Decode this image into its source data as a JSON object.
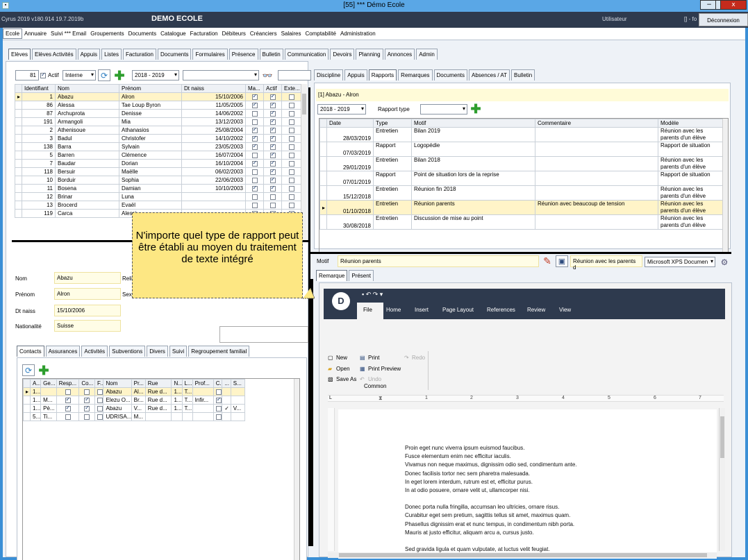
{
  "window": {
    "title": "[55] *** Démo Ecole",
    "app_icon": "app-icon",
    "minimize": "−",
    "maximize": "□",
    "close": "x"
  },
  "appbar": {
    "version": "Cyrus 2019 v180.914 19.7.2019b",
    "school": "DEMO ECOLE",
    "user_label": "Utilisateur",
    "user_suffix": "[] - fo",
    "logout": "Déconnexion"
  },
  "menu": [
    "Ecole",
    "Annuaire",
    "Suivi *** Email",
    "Groupements",
    "Documents",
    "Catalogue",
    "Facturation",
    "Débiteurs",
    "Créanciers",
    "Salaires",
    "Comptabilité",
    "Administration"
  ],
  "subtabs": [
    "Elèves",
    "Elèves Activités",
    "Appuis",
    "Listes",
    "Facturation",
    "Documents",
    "Formulaires",
    "Présence",
    "Bulletin",
    "Communication",
    "Devoirs",
    "Planning",
    "Annonces",
    "Admin"
  ],
  "filter": {
    "count": "81",
    "actif_label": "Actif",
    "type": "Interne",
    "year": "2018 - 2019",
    "search_value": "",
    "search2_value": ""
  },
  "students": {
    "columns": [
      "Identifiant",
      "Nom",
      "Prénom",
      "Dt naiss",
      "Ma...",
      "Actif",
      "Exte..."
    ],
    "rows": [
      {
        "id": "1",
        "nom": "Abazu",
        "prenom": "Alron",
        "dt": "15/10/2006",
        "ma": true,
        "actif": true,
        "ext": false
      },
      {
        "id": "86",
        "nom": "Alessa",
        "prenom": "Tae Loup Byron",
        "dt": "11/05/2005",
        "ma": true,
        "actif": true,
        "ext": false
      },
      {
        "id": "87",
        "nom": "Archuprota",
        "prenom": "Denisse",
        "dt": "14/06/2002",
        "ma": false,
        "actif": true,
        "ext": false
      },
      {
        "id": "191",
        "nom": "Armangoli",
        "prenom": "Mia",
        "dt": "13/12/2003",
        "ma": false,
        "actif": true,
        "ext": false
      },
      {
        "id": "2",
        "nom": "Athenisoue",
        "prenom": "Athanasios",
        "dt": "25/08/2004",
        "ma": true,
        "actif": true,
        "ext": false
      },
      {
        "id": "3",
        "nom": "Badul",
        "prenom": "Christofer",
        "dt": "14/10/2002",
        "ma": true,
        "actif": true,
        "ext": false
      },
      {
        "id": "138",
        "nom": "Barra",
        "prenom": "Sylvain",
        "dt": "23/05/2003",
        "ma": true,
        "actif": true,
        "ext": false
      },
      {
        "id": "5",
        "nom": "Barren",
        "prenom": "Clémence",
        "dt": "16/07/2004",
        "ma": false,
        "actif": true,
        "ext": false
      },
      {
        "id": "7",
        "nom": "Baudar",
        "prenom": "Dorian",
        "dt": "16/10/2004",
        "ma": true,
        "actif": true,
        "ext": false
      },
      {
        "id": "118",
        "nom": "Bersuir",
        "prenom": "Maëlle",
        "dt": "06/02/2003",
        "ma": false,
        "actif": true,
        "ext": false
      },
      {
        "id": "10",
        "nom": "Borduir",
        "prenom": "Sophia",
        "dt": "22/06/2003",
        "ma": false,
        "actif": true,
        "ext": false
      },
      {
        "id": "11",
        "nom": "Bosena",
        "prenom": "Damian",
        "dt": "10/10/2003",
        "ma": true,
        "actif": true,
        "ext": false
      },
      {
        "id": "12",
        "nom": "Brinar",
        "prenom": "Luna",
        "dt": "",
        "ma": false,
        "actif": false,
        "ext": false
      },
      {
        "id": "13",
        "nom": "Brocerd",
        "prenom": "Evaël",
        "dt": "",
        "ma": false,
        "actif": false,
        "ext": false
      },
      {
        "id": "119",
        "nom": "Carca",
        "prenom": "Alessi",
        "dt": "",
        "ma": false,
        "actif": false,
        "ext": false
      }
    ]
  },
  "detail": {
    "nom_label": "Nom",
    "nom": "Abazu",
    "relig_label": "Relig",
    "prenom_label": "Prénom",
    "prenom": "Alron",
    "sexe_label": "Sexe",
    "dtnaiss_label": "Dt naiss",
    "dtnaiss": "15/10/2006",
    "nat_label": "Nationalité",
    "nat": "Suisse"
  },
  "contact_tabs": [
    "Contacts",
    "Assurances",
    "Activités",
    "Subventions",
    "Divers",
    "Suivi",
    "Regroupement familial"
  ],
  "contacts": {
    "columns": [
      "A...",
      "Ge...",
      "Resp...",
      "Co...",
      "F...",
      "Nom",
      "Pr...",
      "Rue",
      "N...",
      "L...",
      "Prof...",
      "C...",
      "...",
      "S..."
    ],
    "rows": [
      {
        "a": "1...",
        "ge": "",
        "resp": false,
        "co": false,
        "f": false,
        "nom": "Abazu",
        "pr": "Al...",
        "rue": "Rue d...",
        "n": "1...",
        "l": "T...",
        "prof": "",
        "c": false,
        "x": "",
        "s": ""
      },
      {
        "a": "1...",
        "ge": "M...",
        "resp": true,
        "co": true,
        "f": false,
        "nom": "Elezu O...",
        "pr": "Br...",
        "rue": "Rue d...",
        "n": "1...",
        "l": "T...",
        "prof": "Infir...",
        "c": true,
        "x": "",
        "s": ""
      },
      {
        "a": "1...",
        "ge": "Pè...",
        "resp": true,
        "co": true,
        "f": false,
        "nom": "Abazu",
        "pr": "V...",
        "rue": "Rue d...",
        "n": "1...",
        "l": "T...",
        "prof": "",
        "c": false,
        "x": "✓",
        "s": "V..."
      },
      {
        "a": "5...",
        "ge": "Ti...",
        "resp": false,
        "co": false,
        "f": false,
        "nom": "UDRISA...",
        "pr": "M...",
        "rue": "",
        "n": "",
        "l": "",
        "prof": "",
        "c": false,
        "x": "",
        "s": ""
      }
    ]
  },
  "right_tabs": [
    "Discipline",
    "Appuis",
    "Rapports",
    "Remarques",
    "Documents",
    "Absences / AT",
    "Bulletin"
  ],
  "selected_student": "[1] Abazu - Alron",
  "report_filter": {
    "year": "2018 - 2019",
    "type_label": "Rapport type",
    "type_value": ""
  },
  "reports": {
    "columns": [
      "Date",
      "Type",
      "Motif",
      "Commentaire",
      "Modèle"
    ],
    "rows": [
      {
        "date": "28/03/2019",
        "type": "Entretien",
        "motif": "Bilan 2019",
        "comment": "",
        "modele": "Réunion avec les parents d'un élève"
      },
      {
        "date": "07/03/2019",
        "type": "Rapport",
        "motif": "Logopédie",
        "comment": "",
        "modele": "Rapport de situation"
      },
      {
        "date": "29/01/2019",
        "type": "Entretien",
        "motif": "Bilan 2018",
        "comment": "",
        "modele": "Réunion avec les parents d'un élève"
      },
      {
        "date": "07/01/2019",
        "type": "Rapport",
        "motif": "Point de situation lors de la reprise",
        "comment": "",
        "modele": "Rapport de situation"
      },
      {
        "date": "15/12/2018",
        "type": "Entretien",
        "motif": "Réunion fin 2018",
        "comment": "",
        "modele": "Réunion avec les parents d'un élève"
      },
      {
        "date": "01/10/2018",
        "type": "Entretien",
        "motif": "Réunion parents",
        "comment": "Réunion avec beaucoup de tension",
        "modele": "Réunion avec les parents d'un élève"
      },
      {
        "date": "30/08/2018",
        "type": "Entretien",
        "motif": "Discussion de mise au point",
        "comment": "",
        "modele": "Réunion avec les parents d'un élève"
      }
    ]
  },
  "motif": {
    "label": "Motif",
    "value": "Réunion parents",
    "modele": "Réunion avec les parents d",
    "printer": "Microsoft XPS Documen"
  },
  "editor_tabs": [
    "Remarque",
    "Présent"
  ],
  "tooltip": "N'importe quel type de rapport peut être établi au moyen du traitement de texte intégré",
  "ribbon": {
    "tabs": [
      "File",
      "Home",
      "Insert",
      "Page Layout",
      "References",
      "Review",
      "View"
    ],
    "new": "New",
    "print": "Print",
    "redo": "Redo",
    "open": "Open",
    "print_preview": "Print Preview",
    "save_as": "Save As",
    "undo": "Undo",
    "group": "Common"
  },
  "document": {
    "p1": [
      "Proin eget nunc viverra ipsum euismod faucibus.",
      "Fusce elementum enim nec efficitur iaculis.",
      "Vivamus non neque maximus, dignissim odio sed, condimentum ante.",
      "Donec facilisis tortor nec sem pharetra malesuada.",
      "In eget lorem interdum, rutrum est et, efficitur purus.",
      "In at odio posuere, ornare velit ut, ullamcorper nisi."
    ],
    "p2": [
      "Donec porta nulla fringilla, accumsan leo ultricies, ornare risus.",
      "Curabitur eget sem pretium, sagittis tellus sit amet, maximus quam.",
      "Phasellus dignissim erat et nunc tempus, in condimentum nibh porta.",
      "Mauris at justo efficitur, aliquam arcu a, cursus justo."
    ],
    "p3": [
      "Sed gravida ligula et quam vulputate, at luctus velit feugiat."
    ]
  },
  "ruler_marks": [
    "1",
    "2",
    "3",
    "4",
    "5",
    "6",
    "7"
  ]
}
